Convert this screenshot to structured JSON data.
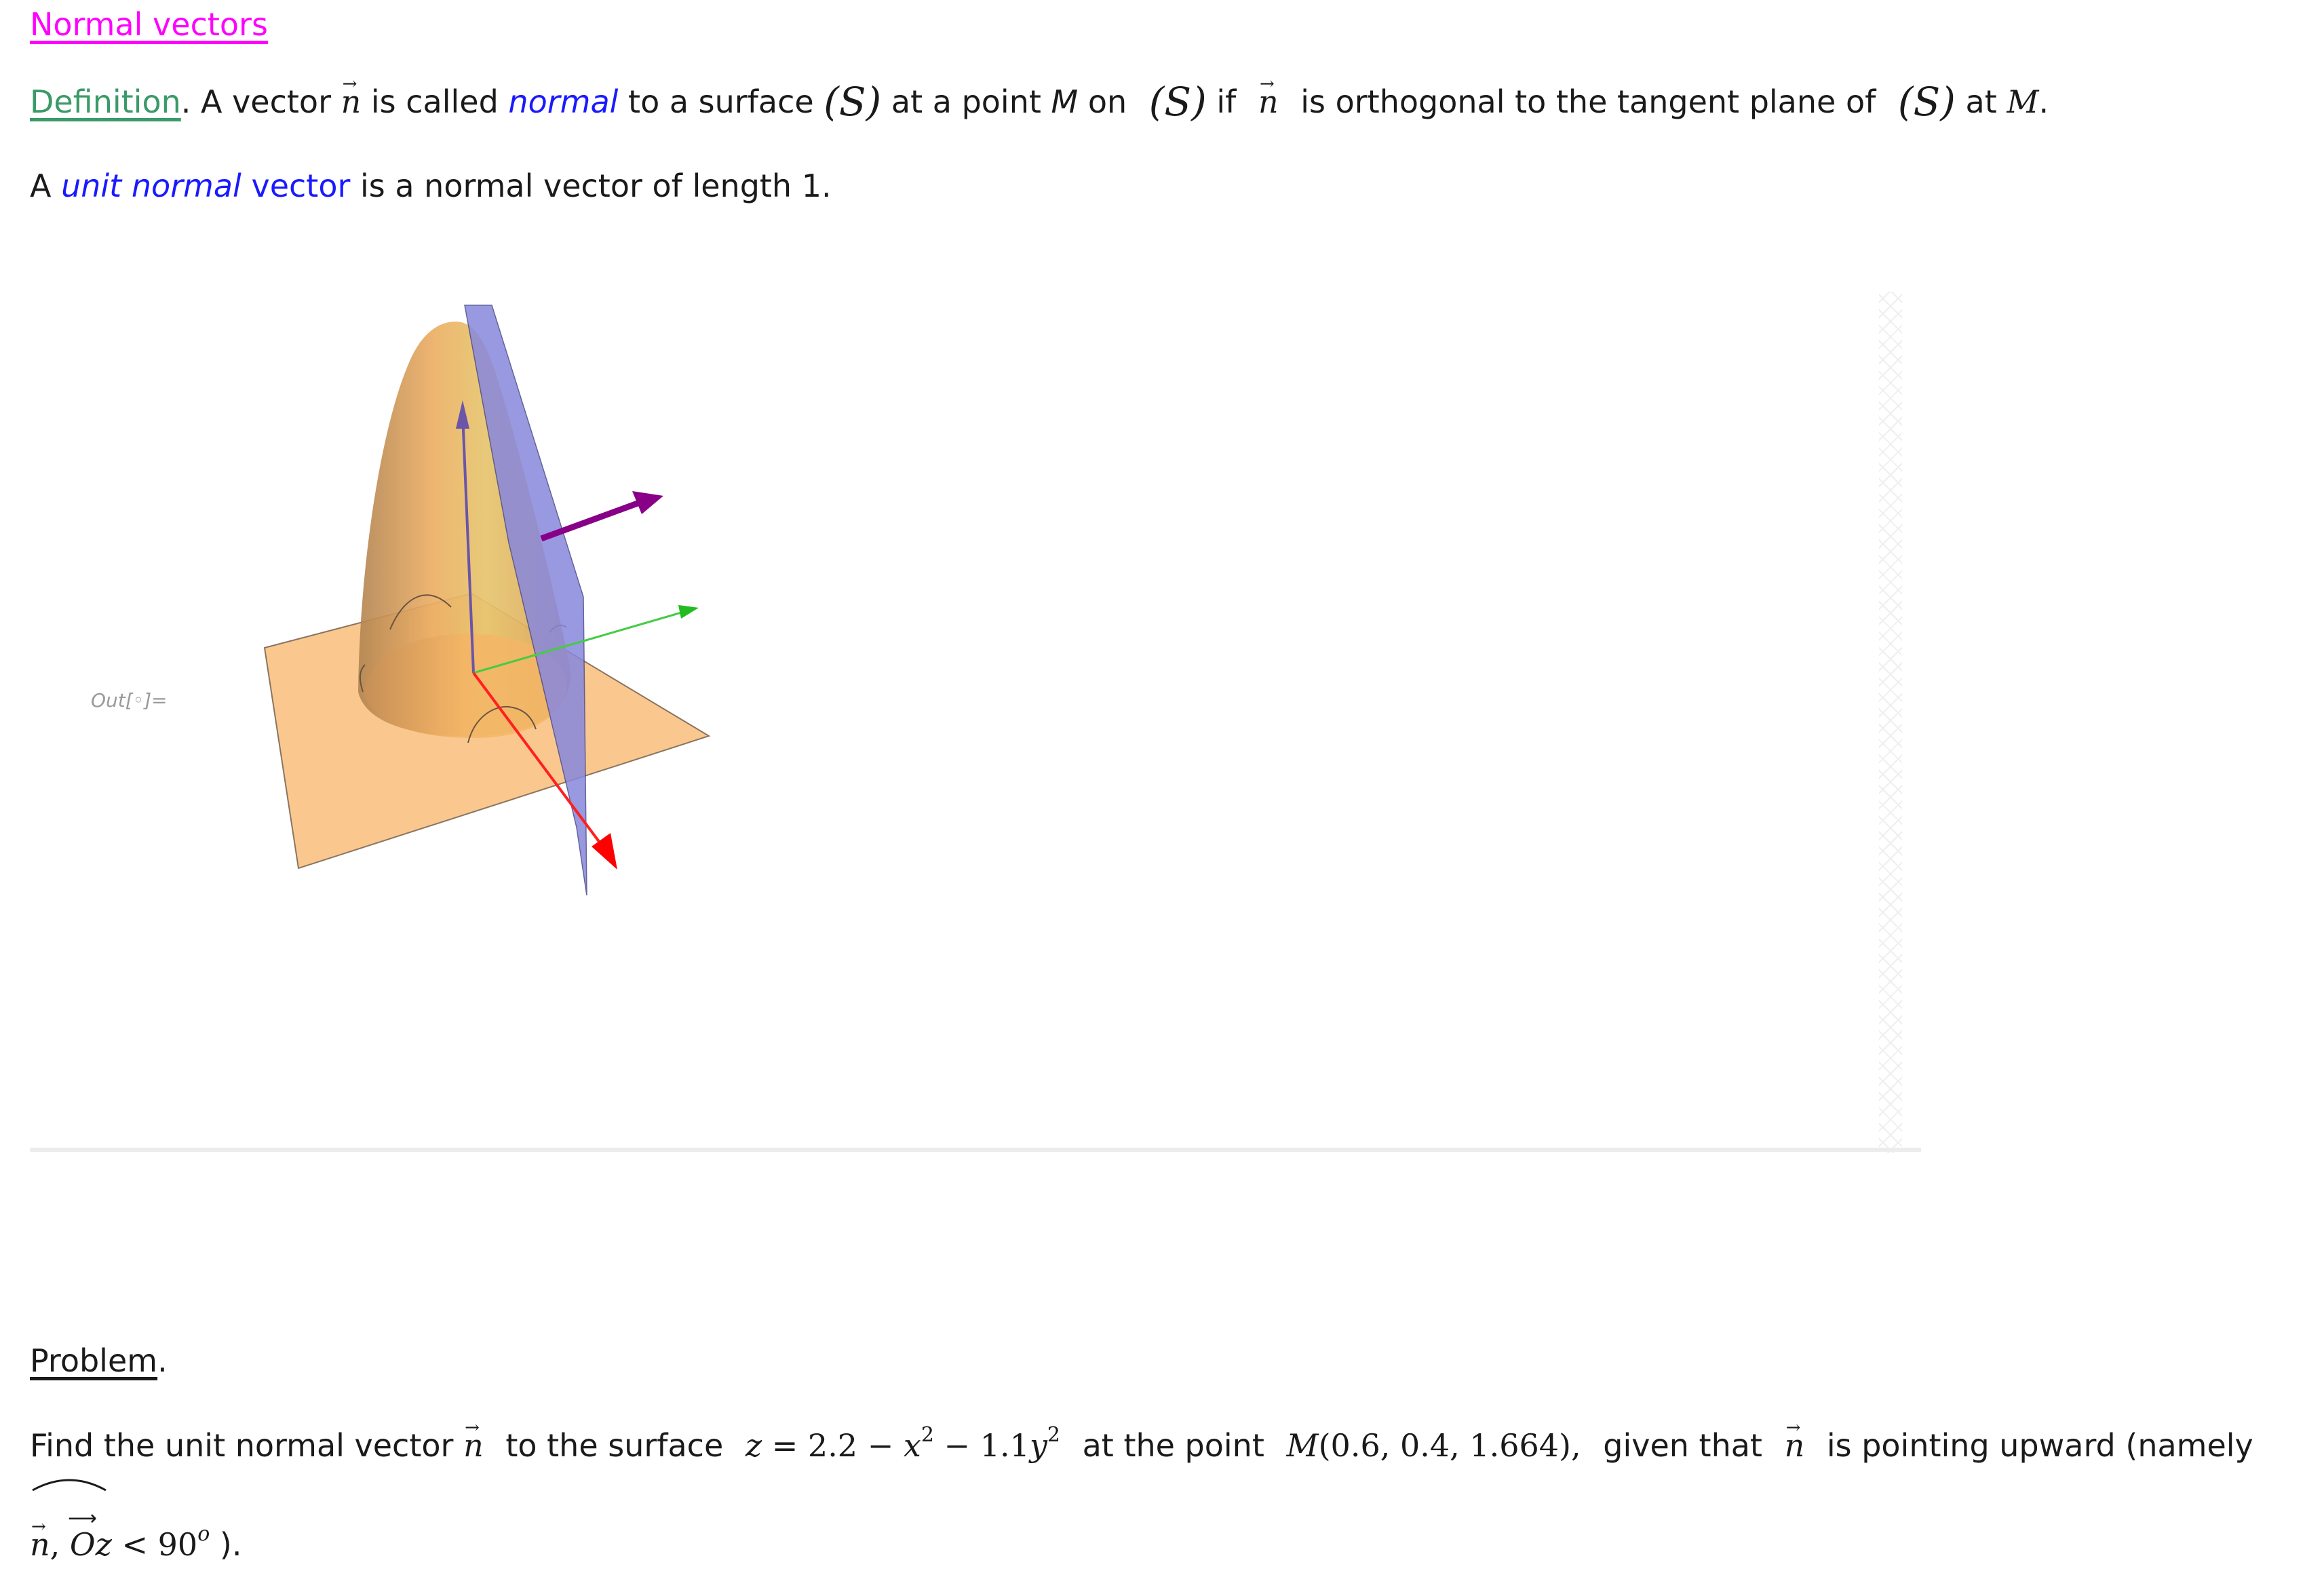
{
  "title": "Normal vectors",
  "definition": {
    "label": "Definition",
    "after_label": ". A vector ",
    "vector_symbol": "n",
    "text_1": " is called ",
    "normal_word": "normal",
    "text_2": " to a surface ",
    "surface": "(S)",
    "text_3": " at a point ",
    "point_M": "M",
    "text_4": " on ",
    "text_5": " if ",
    "text_6": " is orthogonal to the tangent plane of ",
    "text_7": " at ",
    "end": "."
  },
  "unit_normal": {
    "prefix": "A ",
    "term": "unit normal",
    "term_2": " vector",
    "rest": " is a normal vector of length 1."
  },
  "output_label": "Out[◦]=",
  "graphic": {
    "description": "3D plot of surface with tangent plane, normal vector and coordinate axes",
    "colors": {
      "surface": "#f0b060",
      "plane": "#8888dd",
      "normal_vector": "#880088",
      "z_axis": "#6a55a8",
      "x_axis": "#ff1a1a",
      "y_axis": "#33cc33",
      "xy_plane": "#fac88f"
    }
  },
  "problem": {
    "label": "Problem",
    "label_end": ".",
    "text_1": "Find the unit normal vector ",
    "vector_symbol": "n",
    "text_2": " to the surface ",
    "eq_lhs": "z",
    "eq_eq": " = ",
    "eq_c": "2.2",
    "eq_minus": " − ",
    "eq_x": "x",
    "eq_exp": "2",
    "eq_coef": "1.1",
    "eq_y": "y",
    "text_3": " at the point ",
    "point_name": "M",
    "point_coords": "(0.6, 0.4, 1.664),",
    "text_4": " given that ",
    "text_5": " is pointing upward  (namely",
    "angle_n": "n",
    "angle_comma": ", ",
    "angle_oz": "Oz",
    "ineq": " < ",
    "deg_value": "90",
    "deg_sup": "o",
    "close": " )."
  }
}
